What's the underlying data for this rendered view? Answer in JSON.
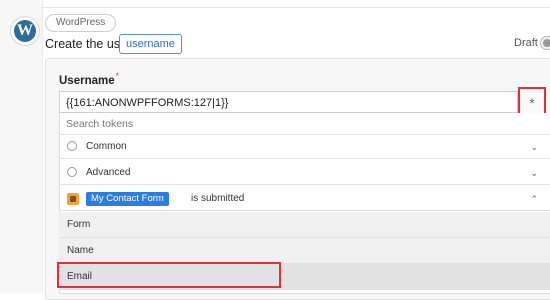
{
  "step": {
    "app_badge": "WordPress",
    "action_title": "Create the user",
    "action_token": "username",
    "status_label": "Draft"
  },
  "field": {
    "label": "Username",
    "required_mark": "*",
    "value": "{{161:ANONWPFFORMS:127|1}}",
    "token_button_icon": "*"
  },
  "token_dropdown": {
    "search_placeholder": "Search tokens",
    "groups": [
      {
        "label": "Common",
        "icon": "pin-icon",
        "expanded": false
      },
      {
        "label": "Advanced",
        "icon": "pin-icon",
        "expanded": false
      }
    ],
    "trigger": {
      "badge": "My Contact Form",
      "suffix": "is submitted",
      "expanded": true,
      "items": [
        "Form",
        "Name",
        "Email"
      ]
    }
  },
  "colors": {
    "highlight": "#e0303a",
    "accent": "#2b7de1"
  }
}
